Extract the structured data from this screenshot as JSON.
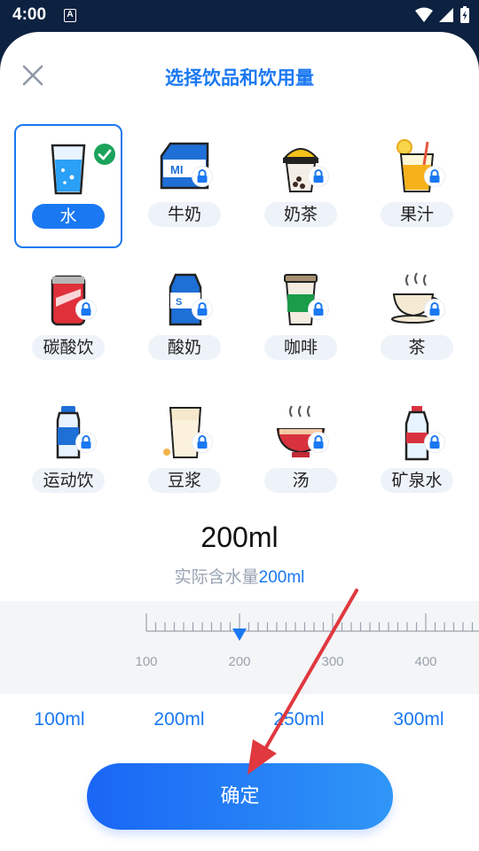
{
  "status_bar": {
    "time": "4:00",
    "notification_letter": "A"
  },
  "dialog": {
    "title": "选择饮品和饮用量"
  },
  "drinks": [
    {
      "label": "水",
      "selected": true,
      "locked": false,
      "icon": "water-glass-icon"
    },
    {
      "label": "牛奶",
      "selected": false,
      "locked": true,
      "icon": "milk-carton-icon"
    },
    {
      "label": "奶茶",
      "selected": false,
      "locked": true,
      "icon": "milk-tea-icon"
    },
    {
      "label": "果汁",
      "selected": false,
      "locked": true,
      "icon": "juice-icon"
    },
    {
      "label": "碳酸饮",
      "selected": false,
      "locked": true,
      "icon": "soda-can-icon"
    },
    {
      "label": "酸奶",
      "selected": false,
      "locked": true,
      "icon": "yogurt-icon"
    },
    {
      "label": "咖啡",
      "selected": false,
      "locked": true,
      "icon": "coffee-cup-icon"
    },
    {
      "label": "茶",
      "selected": false,
      "locked": true,
      "icon": "tea-cup-icon"
    },
    {
      "label": "运动饮",
      "selected": false,
      "locked": true,
      "icon": "sports-drink-icon"
    },
    {
      "label": "豆浆",
      "selected": false,
      "locked": true,
      "icon": "soy-milk-icon"
    },
    {
      "label": "汤",
      "selected": false,
      "locked": true,
      "icon": "soup-bowl-icon"
    },
    {
      "label": "矿泉水",
      "selected": false,
      "locked": true,
      "icon": "mineral-water-icon"
    }
  ],
  "amount": {
    "display": "200ml",
    "water_label": "实际含水量",
    "water_value": "200ml"
  },
  "ruler": {
    "labels": [
      "100",
      "200",
      "300",
      "400"
    ],
    "current_value": 200
  },
  "presets": [
    "100ml",
    "200ml",
    "250ml",
    "300ml"
  ],
  "confirm_label": "确定",
  "colors": {
    "accent": "#1a78f2",
    "check": "#1aa35a",
    "annotation_arrow": "#e0383e",
    "status_bar": "#0d2140"
  }
}
